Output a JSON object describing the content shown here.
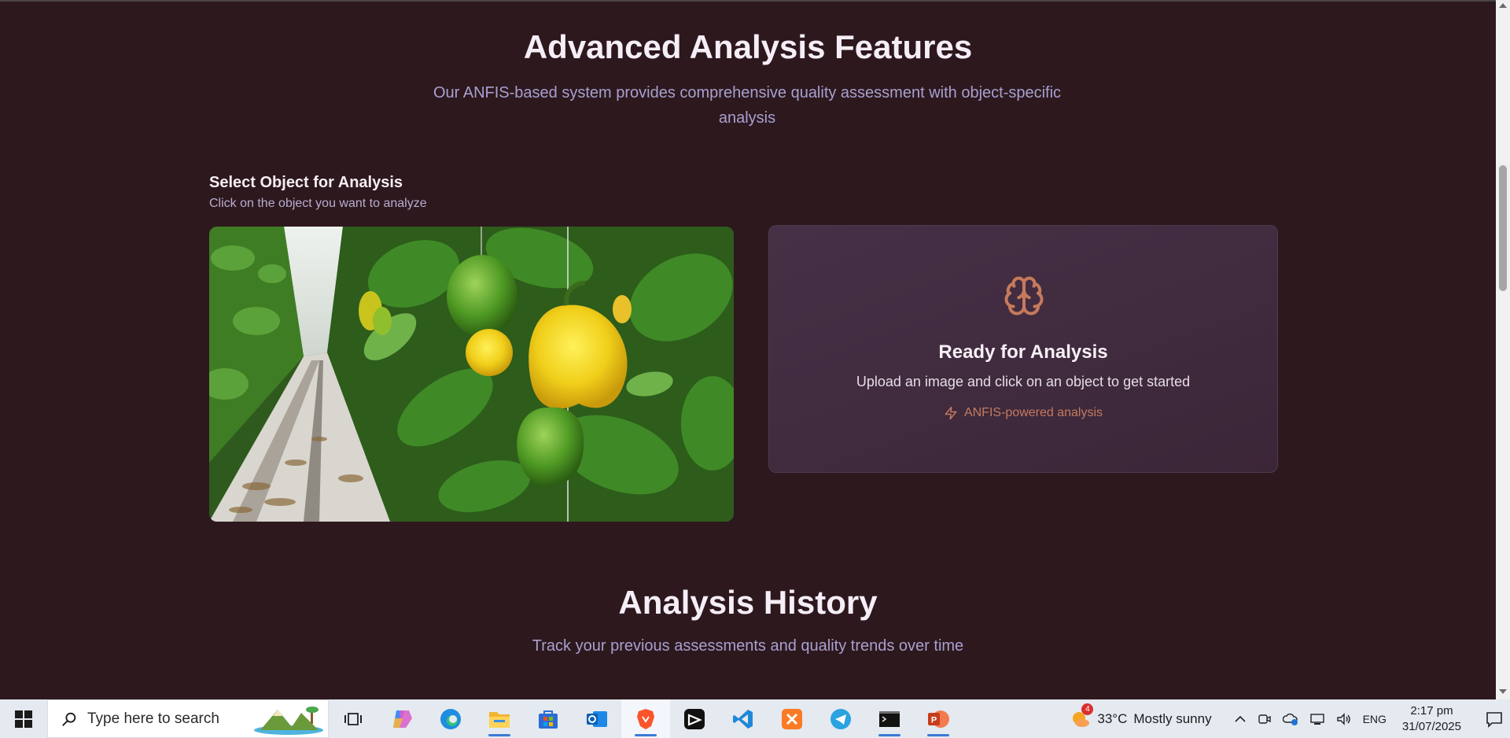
{
  "features": {
    "title": "Advanced Analysis Features",
    "subtitle": "Our ANFIS-based system provides comprehensive quality assessment with object-specific analysis"
  },
  "select": {
    "title": "Select Object for Analysis",
    "subtitle": "Click on the object you want to analyze"
  },
  "ready_card": {
    "icon": "brain-icon",
    "title": "Ready for Analysis",
    "subtitle": "Upload an image and click on an object to get started",
    "badge": "ANFIS-powered analysis",
    "badge_icon": "lightning-icon",
    "accent": "#c47a5c"
  },
  "history": {
    "title": "Analysis History",
    "subtitle": "Track your previous assessments and quality trends over time"
  },
  "taskbar": {
    "search_placeholder": "Type here to search",
    "apps": [
      "task-view",
      "copilot",
      "edge",
      "file-explorer",
      "microsoft-store",
      "outlook",
      "brave",
      "capcut",
      "vs-code",
      "xampp",
      "telegram",
      "terminal",
      "powerpoint"
    ],
    "weather_temp": "33°C",
    "weather_desc": "Mostly sunny",
    "weather_badge": "4",
    "language": "ENG",
    "time": "2:17 pm",
    "date": "31/07/2025"
  },
  "colors": {
    "background": "#2d181e",
    "card": "#433044",
    "muted_text": "#a8a0cf"
  }
}
